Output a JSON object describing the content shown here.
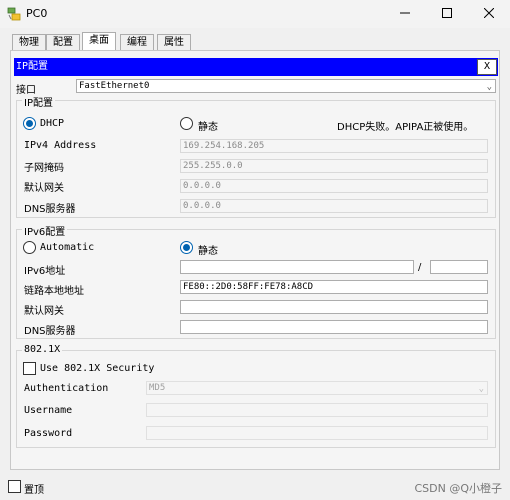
{
  "window": {
    "title": "PC0"
  },
  "tabs": [
    {
      "label": "物理"
    },
    {
      "label": "配置"
    },
    {
      "label": "桌面"
    },
    {
      "label": "编程"
    },
    {
      "label": "属性"
    }
  ],
  "panel": {
    "title": "IP配置",
    "close_label": "X"
  },
  "interface": {
    "label": "接口",
    "value": "FastEthernet0"
  },
  "ipv4": {
    "group_title": "IP配置",
    "dhcp_label": "DHCP",
    "static_label": "静态",
    "dhcp_status": "DHCP失败。APIPA正被使用。",
    "address_label": "IPv4 Address",
    "address_value": "169.254.168.205",
    "mask_label": "子网掩码",
    "mask_value": "255.255.0.0",
    "gateway_label": "默认网关",
    "gateway_value": "0.0.0.0",
    "dns_label": "DNS服务器",
    "dns_value": "0.0.0.0"
  },
  "ipv6": {
    "group_title": "IPv6配置",
    "auto_label": "Automatic",
    "static_label": "静态",
    "address_label": "IPv6地址",
    "address_value": "",
    "prefix_separator": "/",
    "prefix_value": "",
    "link_local_label": "链路本地地址",
    "link_local_value": "FE80::2D0:58FF:FE78:A8CD",
    "gateway_label": "默认网关",
    "gateway_value": "",
    "dns_label": "DNS服务器",
    "dns_value": ""
  },
  "dot1x": {
    "group_title": "802.1X",
    "use_label": "Use 802.1X Security",
    "auth_label": "Authentication",
    "auth_value": "MD5",
    "username_label": "Username",
    "username_value": "",
    "password_label": "Password",
    "password_value": ""
  },
  "footer": {
    "pin_label": "置顶"
  },
  "watermark": "CSDN @Q小橙子"
}
